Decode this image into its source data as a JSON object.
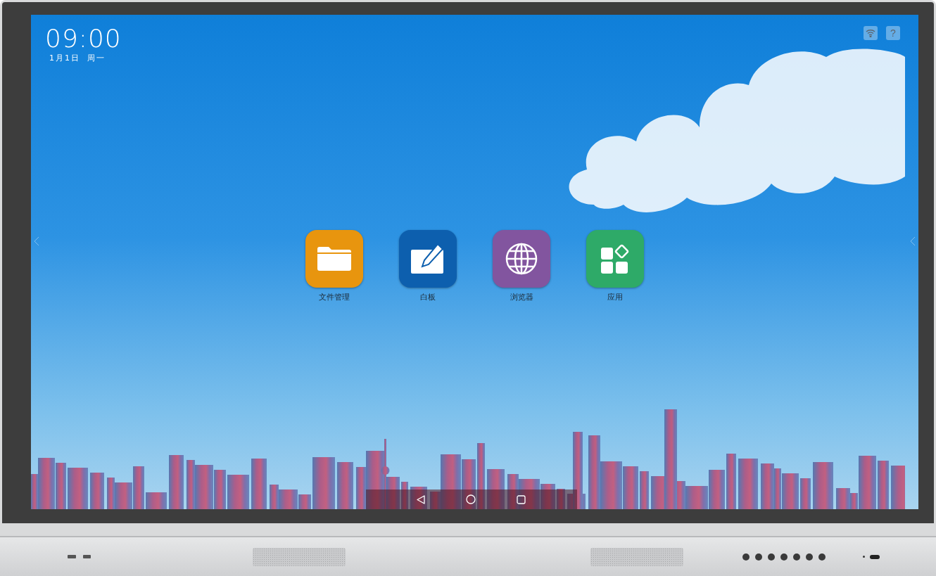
{
  "clock": {
    "time": "09:00",
    "date": "1月1日",
    "weekday": "周一"
  },
  "apps": [
    {
      "label": "文件管理",
      "kind": "folder",
      "color": "#e8950e"
    },
    {
      "label": "白板",
      "kind": "whiteboard",
      "color": "#0d5fae"
    },
    {
      "label": "浏览器",
      "kind": "browser",
      "color": "#82559f"
    },
    {
      "label": "应用",
      "kind": "apps",
      "color": "#2eaa68"
    }
  ],
  "status": {
    "help": "?"
  }
}
